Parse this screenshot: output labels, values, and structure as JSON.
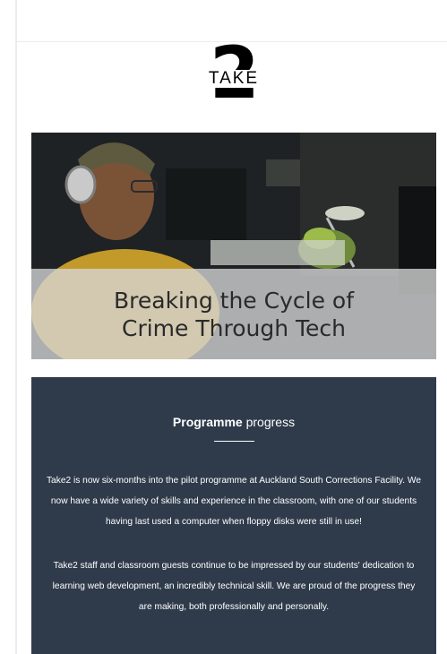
{
  "logo": {
    "number": "2",
    "word": "TAKE"
  },
  "hero": {
    "title": "Breaking the Cycle of\nCrime Through Tech"
  },
  "section": {
    "heading_bold": "Programme",
    "heading_rest": " progress",
    "paragraphs": [
      "Take2 is now six-months into the pilot programme at Auckland South Corrections Facility. We now have a wide variety of skills and experience in the classroom, with one of our students having last used a computer when floppy disks were still in use!",
      "Take2 staff and classroom guests continue to be impressed by our students' dedication to learning web development, an incredibly technical skill. We are proud of the progress they are making, both professionally and personally."
    ]
  },
  "colors": {
    "panel_bg": "#2f3b4b",
    "text_light": "#ffffff",
    "hero_title": "#2a2a2a"
  }
}
